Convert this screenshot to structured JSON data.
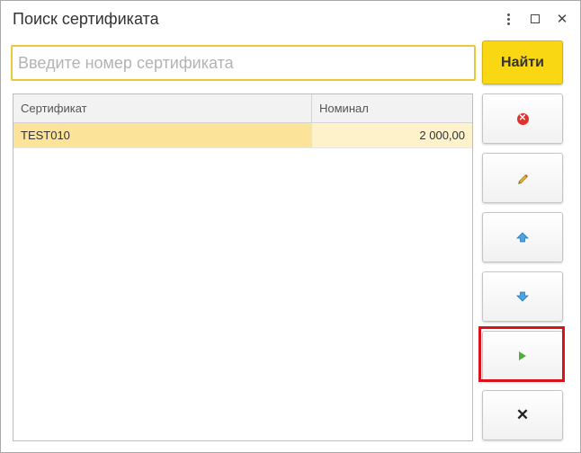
{
  "window": {
    "title": "Поиск сертификата"
  },
  "search": {
    "placeholder": "Введите номер сертификата",
    "value": "",
    "find_label": "Найти"
  },
  "table": {
    "columns": [
      "Сертификат",
      "Номинал"
    ],
    "rows": [
      {
        "certificate": "TEST010",
        "nominal": "2 000,00"
      }
    ]
  },
  "toolbar": {
    "icons": [
      "delete-icon",
      "pencil-icon",
      "arrow-up-icon",
      "arrow-down-icon",
      "play-icon",
      "close-icon"
    ],
    "colors": {
      "accent": "#f9d713",
      "highlight": "#d9121c",
      "selected_row": "#fbe49a"
    }
  }
}
